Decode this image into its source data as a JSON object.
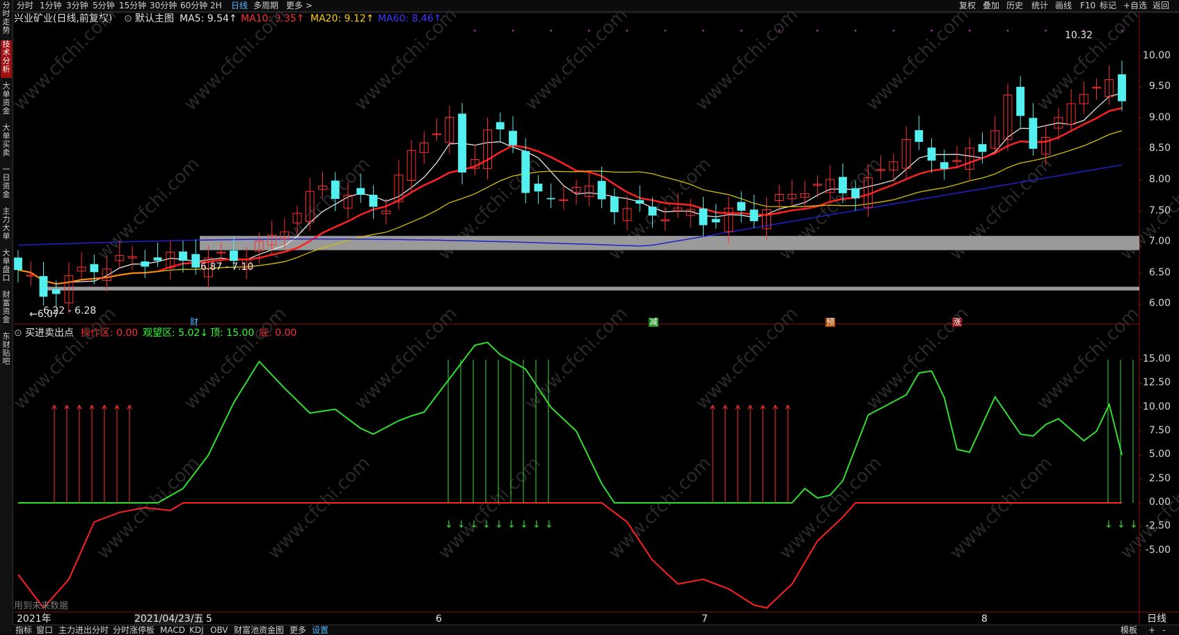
{
  "toolbar": {
    "periods": [
      "分时",
      "1分钟",
      "3分钟",
      "5分钟",
      "15分钟",
      "30分钟",
      "60分钟",
      "2H",
      "日线",
      "多周期",
      "更多 >"
    ],
    "active_period": "日线",
    "right_items": [
      "复权",
      "叠加",
      "历史",
      "统计",
      "画线",
      "F10",
      "标记",
      "+自选",
      "返回"
    ]
  },
  "left_rail": {
    "tabs": [
      "分时走势",
      "技术分析",
      "大单资金",
      "大单买卖",
      "一日资金",
      "主力大单",
      "大单盘口",
      "财富资金",
      "东财贴吧"
    ],
    "active": "技术分析"
  },
  "main_chart": {
    "title": "兴业矿业(日线,前复权)",
    "template": "默认主图",
    "ma_labels": [
      {
        "text": "MA5: 9.54↑",
        "color": "#e6e6e6"
      },
      {
        "text": "MA10: 9.35↑",
        "color": "#ff3030"
      },
      {
        "text": "MA20: 9.12↑",
        "color": "#ffd000"
      },
      {
        "text": "MA60: 8.46↑",
        "color": "#3a3aff"
      }
    ],
    "y_ticks": [
      "10.00",
      "9.50",
      "9.00",
      "8.50",
      "8.00",
      "7.50",
      "7.00",
      "6.50",
      "6.00"
    ],
    "high_label": "10.32",
    "low_label": "←6.07",
    "zone_upper_label": "6.87 - 7.10",
    "zone_lower_label": "6.22 - 6.28",
    "event_tags": [
      {
        "text": "财",
        "color": "#4fb3ff"
      },
      {
        "text": "减",
        "color": "#ffffff",
        "bg": "#1c8c1c"
      },
      {
        "text": "预",
        "color": "#ffffff",
        "bg": "#b04a00"
      },
      {
        "text": "涨",
        "color": "#ffffff",
        "bg": "#8c1010"
      }
    ],
    "colors": {
      "up": "#ff3030",
      "down": "#54f0f0",
      "ma5": "#e6e6e6",
      "ma10": "#ff2020",
      "ma20": "#d6c000",
      "ma60": "#2020d0"
    }
  },
  "sub_chart": {
    "title": "买进卖出点",
    "labels": [
      {
        "text": "操作区: 0.00",
        "color": "#ff3030"
      },
      {
        "text": "观望区: 5.02↓",
        "color": "#30ff30"
      },
      {
        "text": "顶: 15.00",
        "color": "#30ff30"
      },
      {
        "text": "底: 0.00",
        "color": "#ff3030"
      }
    ],
    "y_ticks": [
      "15.00",
      "12.50",
      "10.00",
      "7.50",
      "5.00",
      "2.50",
      "0.00",
      "-2.50",
      "-5.00"
    ],
    "note": "用到未来数据"
  },
  "x_axis": {
    "labels": [
      "2021年",
      "2021/04/23/五",
      "5",
      "6",
      "7",
      "8"
    ],
    "period_label": "日线"
  },
  "bottom_bar": {
    "items": [
      "指标",
      "窗口",
      "主力进出分时",
      "分时涨停板",
      "MACD",
      "KDJ",
      "OBV",
      "财富池资金图",
      "更多",
      "设置"
    ],
    "active": "设置",
    "right": [
      "模板",
      "+",
      "-"
    ]
  },
  "watermark": "www.cfchi.com"
}
